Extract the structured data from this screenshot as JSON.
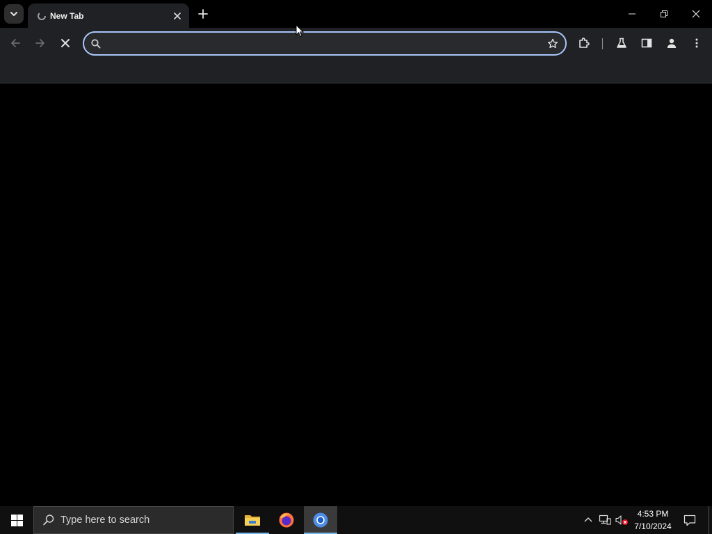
{
  "browser": {
    "tab": {
      "title": "New Tab"
    },
    "omnibox": {
      "value": "",
      "placeholder": ""
    },
    "accent_color": "#a8c7fa"
  },
  "taskbar": {
    "search_placeholder": "Type here to search",
    "apps": [
      "file-explorer",
      "firefox",
      "chromium"
    ],
    "clock": {
      "time": "4:53 PM",
      "date": "7/10/2024"
    }
  }
}
